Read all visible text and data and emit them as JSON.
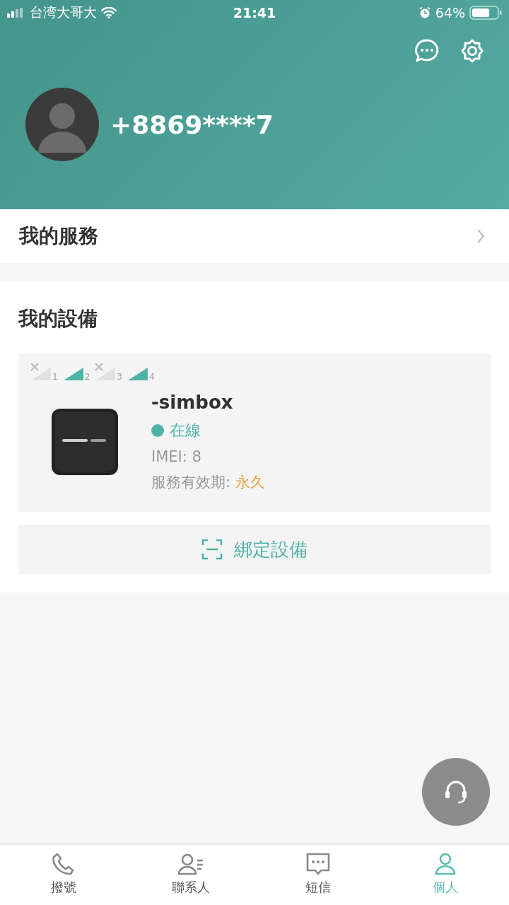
{
  "status_bar": {
    "carrier": "台湾大哥大",
    "time": "21:41",
    "battery": "64%"
  },
  "profile": {
    "phone": "+8869****7"
  },
  "my_services": {
    "title": "我的服務"
  },
  "my_devices": {
    "title": "我的設備",
    "slots": [
      {
        "label": "1",
        "active": false
      },
      {
        "label": "2",
        "active": true
      },
      {
        "label": "3",
        "active": false
      },
      {
        "label": "4",
        "active": true
      }
    ],
    "device": {
      "name": "-simbox",
      "online": true,
      "status": "在線",
      "imei_label": "IMEI:",
      "imei": "8",
      "validity_label": "服務有效期:",
      "validity": "永久"
    },
    "bind_button": "綁定設備"
  },
  "tabs": [
    {
      "label": "撥號",
      "kind": "phone",
      "selected": false
    },
    {
      "label": "聯系人",
      "kind": "contacts",
      "selected": false
    },
    {
      "label": "短信",
      "kind": "message",
      "selected": false
    },
    {
      "label": "個人",
      "kind": "person",
      "selected": true
    }
  ]
}
